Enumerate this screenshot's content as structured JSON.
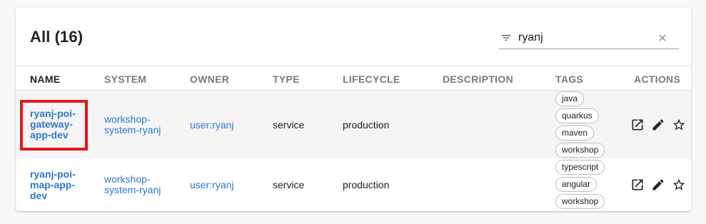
{
  "table": {
    "title": "All (16)",
    "search": {
      "value": "ryanj",
      "placeholder": "Filter"
    },
    "columns": [
      "NAME",
      "SYSTEM",
      "OWNER",
      "TYPE",
      "LIFECYCLE",
      "DESCRIPTION",
      "TAGS",
      "ACTIONS"
    ],
    "rows": [
      {
        "name": "ryanj-poi-gateway-app-dev",
        "system": "workshop-system-ryanj",
        "owner": "user:ryanj",
        "type": "service",
        "lifecycle": "production",
        "description": "",
        "tags": [
          "java",
          "quarkus",
          "maven",
          "workshop"
        ]
      },
      {
        "name": "ryanj-poi-map-app-dev",
        "system": "workshop-system-ryanj",
        "owner": "user:ryanj",
        "type": "service",
        "lifecycle": "production",
        "description": "",
        "tags": [
          "typescript",
          "angular",
          "workshop"
        ]
      }
    ]
  },
  "icons": {
    "filter": "filter-icon",
    "clear": "close-icon",
    "actions": [
      "open-in-new-icon",
      "edit-pencil-icon",
      "star-outline-icon"
    ]
  },
  "colors": {
    "link": "#2e77d0",
    "highlight": "#e8141b",
    "row_alt": "#f5f5f5"
  }
}
